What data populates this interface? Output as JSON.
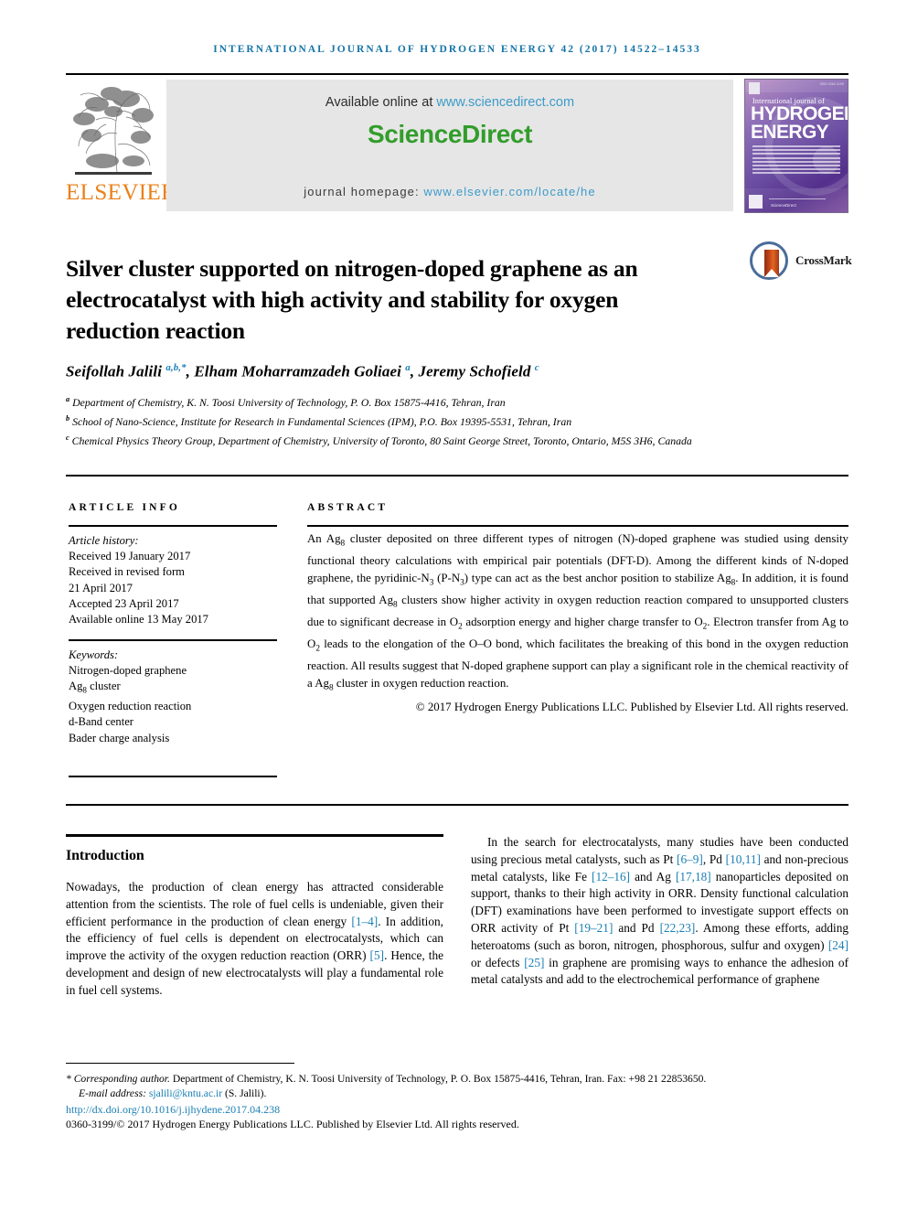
{
  "running_head": "International Journal of Hydrogen Energy 42 (2017) 14522–14533",
  "masthead": {
    "available_text": "Available online at ",
    "sciencedirect_url": "www.sciencedirect.com",
    "sciencedirect_logo": "ScienceDirect",
    "homepage_label": "journal homepage: ",
    "homepage_url": "www.elsevier.com/locate/he",
    "elsevier_wordmark": "ELSEVIER",
    "cover": {
      "line_ijof": "International journal of",
      "line_hydrogen": "HYDROGEN",
      "line_energy": "ENERGY",
      "issn": "ISSN 0360-3199",
      "publisher": "ScienceDirect"
    }
  },
  "title": "Silver cluster supported on nitrogen-doped graphene as an electrocatalyst with high activity and stability for oxygen reduction reaction",
  "crossmark_label": "CrossMark",
  "authors_html": "Seifollah Jalili <sup>a,b,*</sup>, Elham Moharramzadeh Goliaei <sup>a</sup>, Jeremy Schofield <sup>c</sup>",
  "affiliations": [
    "a Department of Chemistry, K. N. Toosi University of Technology, P. O. Box 15875-4416, Tehran, Iran",
    "b School of Nano-Science, Institute for Research in Fundamental Sciences (IPM), P.O. Box 19395-5531, Tehran, Iran",
    "c Chemical Physics Theory Group, Department of Chemistry, University of Toronto, 80 Saint George Street, Toronto, Ontario, M5S 3H6, Canada"
  ],
  "article_info": {
    "heading": "ARTICLE INFO",
    "history_label": "Article history:",
    "history": [
      "Received 19 January 2017",
      "Received in revised form",
      "21 April 2017",
      "Accepted 23 April 2017",
      "Available online 13 May 2017"
    ],
    "keywords_label": "Keywords:",
    "keywords": [
      "Nitrogen-doped graphene",
      "Ag8 cluster",
      "Oxygen reduction reaction",
      "d-Band center",
      "Bader charge analysis"
    ]
  },
  "abstract": {
    "heading": "ABSTRACT",
    "body_html": "An Ag<sub>8</sub> cluster deposited on three different types of nitrogen (N)-doped graphene was studied using density functional theory calculations with empirical pair potentials (DFT-D). Among the different kinds of N-doped graphene, the pyridinic-N<sub>3</sub> (P-N<sub>3</sub>) type can act as the best anchor position to stabilize Ag<sub>8</sub>. In addition, it is found that supported Ag<sub>8</sub> clusters show higher activity in oxygen reduction reaction compared to unsupported clusters due to significant decrease in O<sub>2</sub> adsorption energy and higher charge transfer to O<sub>2</sub>. Electron transfer from Ag to O<sub>2</sub> leads to the elongation of the O–O bond, which facilitates the breaking of this bond in the oxygen reduction reaction. All results suggest that N-doped graphene support can play a significant role in the chemical reactivity of a Ag<sub>8</sub> cluster in oxygen reduction reaction.",
    "copyright": "© 2017 Hydrogen Energy Publications LLC. Published by Elsevier Ltd. All rights reserved."
  },
  "introduction": {
    "heading": "Introduction",
    "paragraph_html": "Nowadays, the production of clean energy has attracted considerable attention from the scientists. The role of fuel cells is undeniable, given their efficient performance in the production of clean energy <span class=\"ref\">[1–4]</span>. In addition, the efficiency of fuel cells is dependent on electrocatalysts, which can improve the activity of the oxygen reduction reaction (ORR) <span class=\"ref\">[5]</span>. Hence, the development and design of new electrocatalysts will play a fundamental role in fuel cell systems."
  },
  "right_column": {
    "paragraph_html": "In the search for electrocatalysts, many studies have been conducted using precious metal catalysts, such as Pt <span class=\"ref\">[6–9]</span>, Pd <span class=\"ref\">[10,11]</span> and non-precious metal catalysts, like Fe <span class=\"ref\">[12–16]</span> and Ag <span class=\"ref\">[17,18]</span> nanoparticles deposited on support, thanks to their high activity in ORR. Density functional calculation (DFT) examinations have been performed to investigate support effects on ORR activity of Pt <span class=\"ref\">[19–21]</span> and Pd <span class=\"ref\">[22,23]</span>. Among these efforts, adding heteroatoms (such as boron, nitrogen, phosphorous, sulfur and oxygen) <span class=\"ref\">[24]</span> or defects <span class=\"ref\">[25]</span> in graphene are promising ways to enhance the adhesion of metal catalysts and add to the electrochemical performance of graphene"
  },
  "footer": {
    "corresponding_html": "<span class=\"corr\">* Corresponding author.</span> Department of Chemistry, K. N. Toosi University of Technology, P. O. Box 15875-4416, Tehran, Iran. Fax: +98 21 22853650.",
    "email_label": "E-mail address: ",
    "email": "sjalili@kntu.ac.ir",
    "email_suffix": " (S. Jalili).",
    "doi": "http://dx.doi.org/10.1016/j.ijhydene.2017.04.238",
    "issn_line": "0360-3199/© 2017 Hydrogen Energy Publications LLC. Published by Elsevier Ltd. All rights reserved."
  },
  "colors": {
    "link": "#1a7fb3",
    "running_head": "#1574a6",
    "sciencedirect_green": "#329d2b",
    "elsevier_orange": "#ea8019",
    "sd_link_blue": "#3d9bc9"
  }
}
